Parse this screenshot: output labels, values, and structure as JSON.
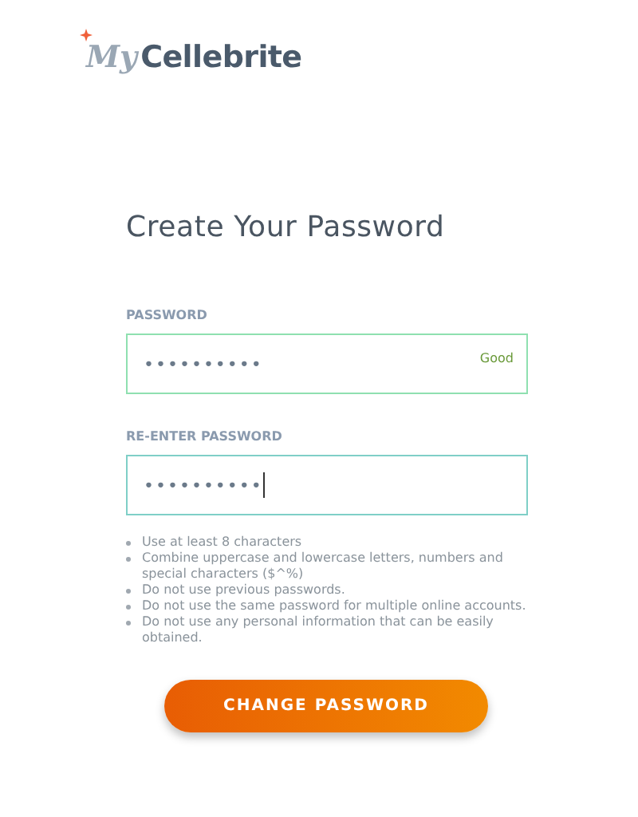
{
  "logo": {
    "script": "My",
    "name": "Cellebrite"
  },
  "title": "Create Your Password",
  "fields": [
    {
      "label": "PASSWORD",
      "value": "••••••••••",
      "strength": "Good",
      "focused": false
    },
    {
      "label": "RE-ENTER PASSWORD",
      "value": "••••••••••",
      "focused": true
    }
  ],
  "rules": [
    "Use at least 8 characters",
    "Combine uppercase and lowercase letters, numbers and special characters ($^%)",
    "Do not use previous passwords.",
    "Do not use the same password for multiple online accounts.",
    "Do not use any personal information that can be easily obtained."
  ],
  "button": "CHANGE PASSWORD"
}
